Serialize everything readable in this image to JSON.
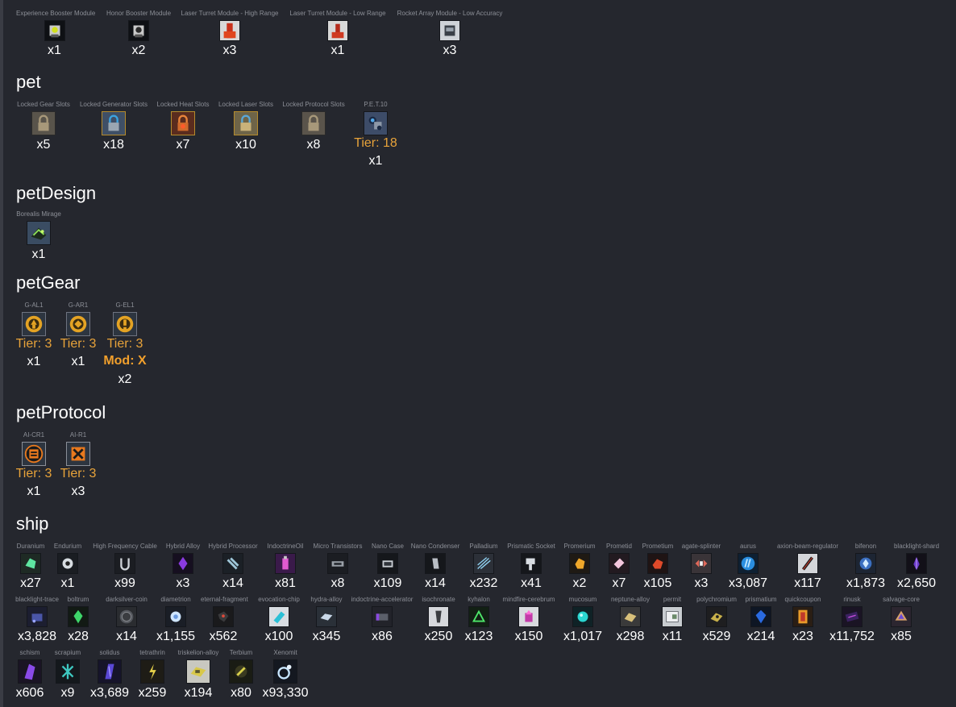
{
  "modules": {
    "items": [
      {
        "name": "Experience Booster Module",
        "qty": "x1"
      },
      {
        "name": "Honor Booster Module",
        "qty": "x2"
      },
      {
        "name": "Laser Turret Module - High Range",
        "qty": "x3"
      },
      {
        "name": "Laser Turret Module - Low Range",
        "qty": "x1"
      },
      {
        "name": "Rocket Array Module - Low Accuracy",
        "qty": "x3"
      }
    ]
  },
  "pet": {
    "title": "pet",
    "items": [
      {
        "name": "Locked Gear Slots",
        "qty": "x5"
      },
      {
        "name": "Locked Generator Slots",
        "qty": "x18"
      },
      {
        "name": "Locked Heat Slots",
        "qty": "x7"
      },
      {
        "name": "Locked Laser Slots",
        "qty": "x10"
      },
      {
        "name": "Locked Protocol Slots",
        "qty": "x8"
      },
      {
        "name": "P.E.T.10",
        "tier": "Tier: 18",
        "qty": "x1"
      }
    ]
  },
  "petDesign": {
    "title": "petDesign",
    "items": [
      {
        "name": "Borealis Mirage",
        "qty": "x1"
      }
    ]
  },
  "petGear": {
    "title": "petGear",
    "items": [
      {
        "name": "G-AL1",
        "tier": "Tier: 3",
        "qty": "x1"
      },
      {
        "name": "G-AR1",
        "tier": "Tier: 3",
        "qty": "x1"
      },
      {
        "name": "G-EL1",
        "tier": "Tier: 3",
        "mod": "Mod: X",
        "qty": "x2"
      }
    ]
  },
  "petProtocol": {
    "title": "petProtocol",
    "items": [
      {
        "name": "AI-CR1",
        "tier": "Tier: 3",
        "qty": "x1"
      },
      {
        "name": "AI-R1",
        "tier": "Tier: 3",
        "qty": "x3"
      }
    ]
  },
  "ship": {
    "title": "ship",
    "row1": [
      {
        "name": "Duranium",
        "qty": "x27"
      },
      {
        "name": "Endurium",
        "qty": "x1"
      },
      {
        "name": "High Frequency Cable",
        "qty": "x99"
      },
      {
        "name": "Hybrid Alloy",
        "qty": "x3"
      },
      {
        "name": "Hybrid Processor",
        "qty": "x14"
      },
      {
        "name": "IndoctrineOil",
        "qty": "x81"
      },
      {
        "name": "Micro Transistors",
        "qty": "x8"
      },
      {
        "name": "Nano Case",
        "qty": "x109"
      },
      {
        "name": "Nano Condenser",
        "qty": "x14"
      },
      {
        "name": "Palladium",
        "qty": "x232"
      },
      {
        "name": "Prismatic Socket",
        "qty": "x41"
      },
      {
        "name": "Promerium",
        "qty": "x2"
      },
      {
        "name": "Prometid",
        "qty": "x7"
      },
      {
        "name": "Prometium",
        "qty": "x105"
      },
      {
        "name": "agate-splinter",
        "qty": "x3"
      },
      {
        "name": "aurus",
        "qty": "x3,087"
      },
      {
        "name": "axion-beam-regulator",
        "qty": "x117"
      },
      {
        "name": "bifenon",
        "qty": "x1,873"
      },
      {
        "name": "blacklight-shard",
        "qty": "x2,650"
      }
    ],
    "row2": [
      {
        "name": "blacklight-trace",
        "qty": "x3,828"
      },
      {
        "name": "boltrum",
        "qty": "x28"
      },
      {
        "name": "darksilver-coin",
        "qty": "x14"
      },
      {
        "name": "diametrion",
        "qty": "x1,155"
      },
      {
        "name": "eternal-fragment",
        "qty": "x562"
      },
      {
        "name": "evocation-chip",
        "qty": "x100"
      },
      {
        "name": "hydra-alloy",
        "qty": "x345"
      },
      {
        "name": "indoctrine-accelerator",
        "qty": "x86"
      },
      {
        "name": "isochronate",
        "qty": "x250"
      },
      {
        "name": "kyhalon",
        "qty": "x123"
      },
      {
        "name": "mindfire-cerebrum",
        "qty": "x150"
      },
      {
        "name": "mucosum",
        "qty": "x1,017"
      },
      {
        "name": "neptune-alloy",
        "qty": "x298"
      },
      {
        "name": "permit",
        "qty": "x11"
      },
      {
        "name": "polychromium",
        "qty": "x529"
      },
      {
        "name": "prismatium",
        "qty": "x214"
      },
      {
        "name": "quickcoupon",
        "qty": "x23"
      },
      {
        "name": "rinusk",
        "qty": "x11,752"
      },
      {
        "name": "salvage-core",
        "qty": "x85"
      }
    ],
    "row3": [
      {
        "name": "schism",
        "qty": "x606"
      },
      {
        "name": "scrapium",
        "qty": "x9"
      },
      {
        "name": "solidus",
        "qty": "x3,689"
      },
      {
        "name": "tetrathrin",
        "qty": "x259"
      },
      {
        "name": "triskelion-alloy",
        "qty": "x194"
      },
      {
        "name": "Terbium",
        "qty": "x80"
      },
      {
        "name": "Xenomit",
        "qty": "x93,330"
      }
    ]
  },
  "colors": {
    "background": "#25272e",
    "tier": "#e8a33a",
    "mod": "#f2a02c",
    "label": "#8c8f97"
  }
}
